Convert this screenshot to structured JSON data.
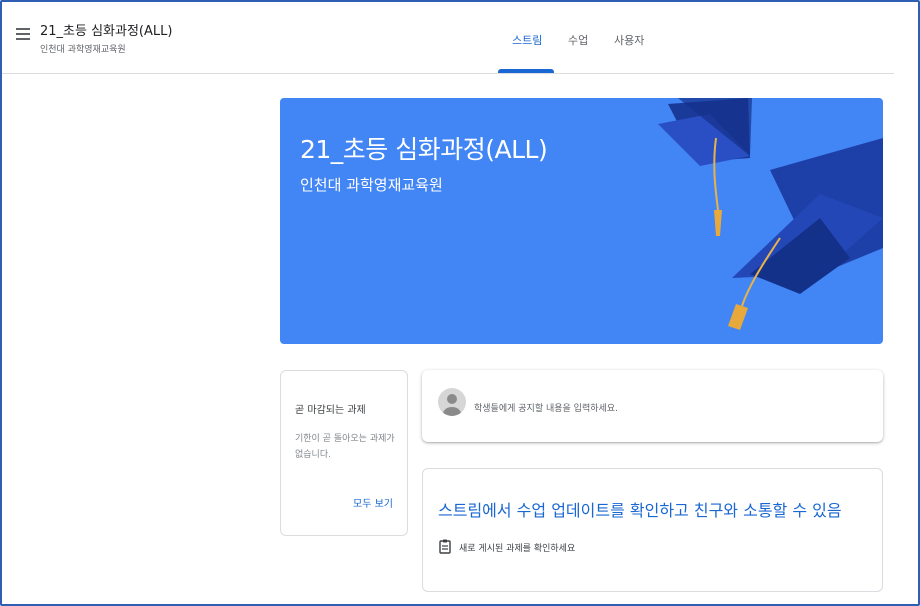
{
  "header": {
    "class_title": "21_초등 심화과정(ALL)",
    "class_subtitle": "인천대 과학영재교육원",
    "tabs": [
      {
        "label": "스트림",
        "active": true
      },
      {
        "label": "수업",
        "active": false
      },
      {
        "label": "사용자",
        "active": false
      }
    ]
  },
  "banner": {
    "title": "21_초등 심화과정(ALL)",
    "subtitle": "인천대 과학영재교육원",
    "background_color": "#4285f4"
  },
  "upcoming": {
    "title": "곧 마감되는 과제",
    "empty_text": "기한이 곧 돌아오는 과제가 없습니다.",
    "view_all_label": "모두 보기"
  },
  "composer": {
    "placeholder": "학생들에게 공지할 내용을 입력하세요."
  },
  "info_card": {
    "title": "스트림에서 수업 업데이트를 확인하고 친구와 소통할 수 있음",
    "item_text": "새로 게시된 과제를 확인하세요",
    "item_icon": "assignment-icon"
  },
  "colors": {
    "accent": "#1967d2",
    "banner": "#4285f4",
    "frame": "#2f5fb3"
  }
}
